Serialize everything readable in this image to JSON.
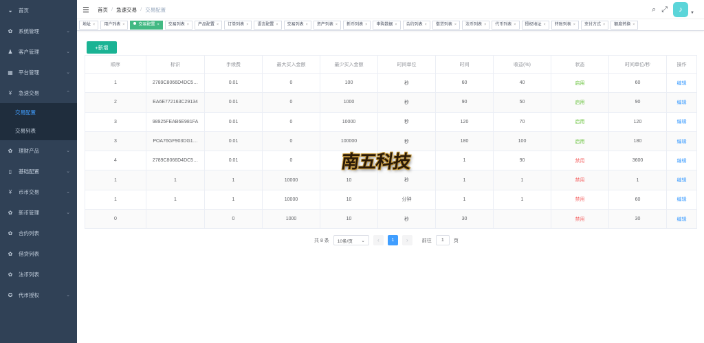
{
  "sidebar": {
    "items": [
      {
        "icon": "dashboard-icon",
        "glyph": "◒",
        "label": "首页",
        "arrow": false
      },
      {
        "icon": "gear-icon",
        "glyph": "✿",
        "label": "系统管理",
        "arrow": true
      },
      {
        "icon": "user-icon",
        "glyph": "♟",
        "label": "客户管理",
        "arrow": true
      },
      {
        "icon": "grid-icon",
        "glyph": "▦",
        "label": "平台管理",
        "arrow": true
      },
      {
        "icon": "yen-icon",
        "glyph": "¥",
        "label": "急速交易",
        "arrow": true,
        "expanded": true
      }
    ],
    "sub_items": [
      {
        "label": "交易配置",
        "active": true
      },
      {
        "label": "交易列表",
        "active": false
      }
    ],
    "items_after": [
      {
        "icon": "gear-icon",
        "glyph": "✿",
        "label": "理财产品",
        "arrow": true
      },
      {
        "icon": "book-icon",
        "glyph": "▯",
        "label": "基础配置",
        "arrow": true
      },
      {
        "icon": "yen-icon",
        "glyph": "¥",
        "label": "币币交易",
        "arrow": true
      },
      {
        "icon": "gear-icon",
        "glyph": "✿",
        "label": "新币管理",
        "arrow": true
      },
      {
        "icon": "gear-icon",
        "glyph": "✿",
        "label": "合约列表",
        "arrow": false
      },
      {
        "icon": "gear-icon",
        "glyph": "✿",
        "label": "借贷列表",
        "arrow": false
      },
      {
        "icon": "gear-icon",
        "glyph": "✿",
        "label": "法币列表",
        "arrow": false
      },
      {
        "icon": "compass-icon",
        "glyph": "✪",
        "label": "代币授权",
        "arrow": true
      }
    ]
  },
  "navbar": {
    "breadcrumb": [
      "首页",
      "急速交易",
      "交易配置"
    ]
  },
  "tags": [
    {
      "label": "地址",
      "active": false
    },
    {
      "label": "用户列表",
      "active": false
    },
    {
      "label": "交易配置",
      "active": true
    },
    {
      "label": "交易列表",
      "active": false
    },
    {
      "label": "产品配置",
      "active": false
    },
    {
      "label": "订单列表",
      "active": false
    },
    {
      "label": "语言配置",
      "active": false
    },
    {
      "label": "交易列表",
      "active": false
    },
    {
      "label": "资产列表",
      "active": false
    },
    {
      "label": "新币列表",
      "active": false
    },
    {
      "label": "申购数据",
      "active": false
    },
    {
      "label": "合约列表",
      "active": false
    },
    {
      "label": "借贷列表",
      "active": false
    },
    {
      "label": "法币列表",
      "active": false
    },
    {
      "label": "代币列表",
      "active": false
    },
    {
      "label": "授权地址",
      "active": false
    },
    {
      "label": "转账列表",
      "active": false
    },
    {
      "label": "支付方式",
      "active": false
    },
    {
      "label": "额度转换",
      "active": false
    }
  ],
  "add_button": "+新增",
  "table": {
    "headers": [
      "顺序",
      "标识",
      "手续费",
      "最大买入金额",
      "最少买入金额",
      "时间单位",
      "时间",
      "收益(%)",
      "状态",
      "时间单位/秒",
      "操作"
    ],
    "rows": [
      [
        "1",
        "2789C8066D4DC5…",
        "0.01",
        "0",
        "100",
        "秒",
        "60",
        "40",
        "启用",
        "60",
        "编辑"
      ],
      [
        "2",
        "EA6E772163C29134",
        "0.01",
        "0",
        "1000",
        "秒",
        "90",
        "50",
        "启用",
        "90",
        "编辑"
      ],
      [
        "3",
        "98925FEAB6E981FA",
        "0.01",
        "0",
        "10000",
        "秒",
        "120",
        "70",
        "启用",
        "120",
        "编辑"
      ],
      [
        "3",
        "POA76GF903DG1…",
        "0.01",
        "0",
        "100000",
        "秒",
        "180",
        "100",
        "启用",
        "180",
        "编辑"
      ],
      [
        "4",
        "2789C8066D4DC5…",
        "0.01",
        "0",
        "",
        "",
        "1",
        "90",
        "禁用",
        "3600",
        "编辑"
      ],
      [
        "1",
        "1",
        "1",
        "10000",
        "10",
        "秒",
        "1",
        "1",
        "禁用",
        "1",
        "编辑"
      ],
      [
        "1",
        "1",
        "1",
        "10000",
        "10",
        "分钟",
        "1",
        "1",
        "禁用",
        "60",
        "编辑"
      ],
      [
        "0",
        "",
        "0",
        "1000",
        "10",
        "秒",
        "30",
        "",
        "禁用",
        "30",
        "编辑"
      ]
    ]
  },
  "pagination": {
    "total": "共 8 条",
    "page_size": "10条/页",
    "current_page": "1",
    "goto_label": "前往",
    "goto_value": "1",
    "page_suffix": "页"
  },
  "watermark": "南五科技",
  "colors": {
    "sidebar_bg": "#304156",
    "active_tag": "#42b983",
    "add_button": "#1ab394",
    "enabled": "#67c23a",
    "disabled": "#f56c6c",
    "link": "#409eff"
  }
}
